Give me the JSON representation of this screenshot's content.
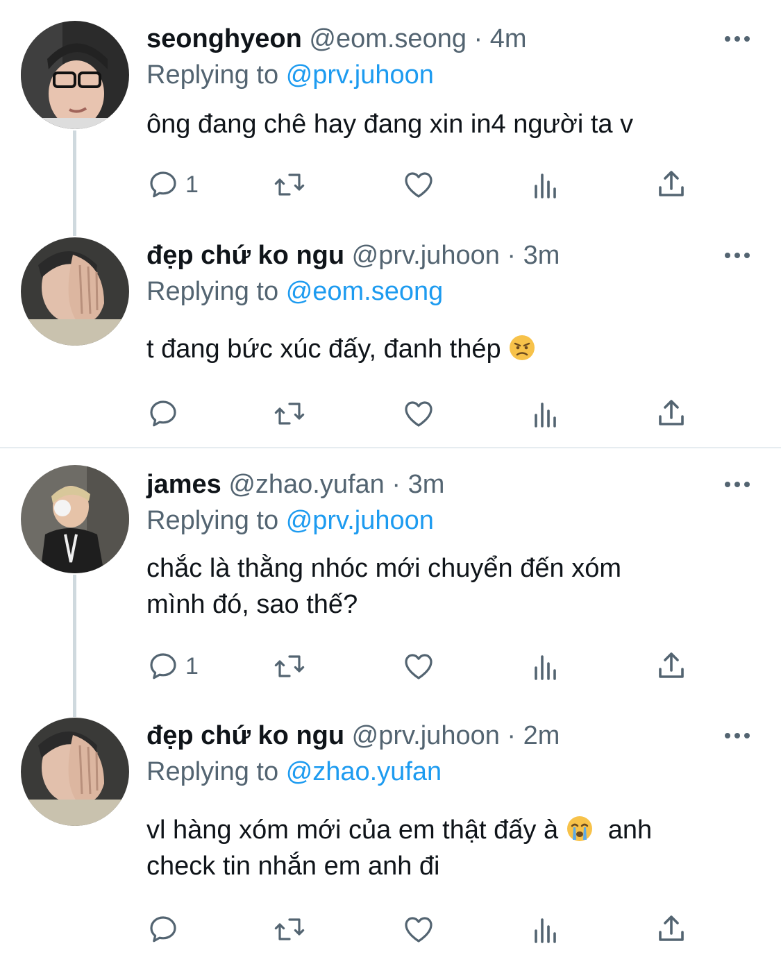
{
  "colors": {
    "text": "#0f1419",
    "secondary": "#536471",
    "link": "#1d9bf0",
    "thread_line": "#cfd9de",
    "divider": "#e6ecf0"
  },
  "tweets": [
    {
      "name": "seonghyeon",
      "handle": "@eom.seong",
      "dot": "·",
      "time": "4m",
      "replying_prefix": "Replying to",
      "replying_to": "@prv.juhoon",
      "text_lines": [
        "ông đang chê hay đang xin in4 người ta v"
      ],
      "reply_count": "1",
      "avatar_icon": "avatar-photo"
    },
    {
      "name": "đẹp chứ ko ngu",
      "handle": "@prv.juhoon",
      "dot": "·",
      "time": "3m",
      "replying_prefix": "Replying to",
      "replying_to": "@eom.seong",
      "text_lines": [
        "t đang bức xúc đấy, đanh thép"
      ],
      "emoji": "angry-face-emoji",
      "reply_count": "",
      "avatar_icon": "avatar-photo"
    },
    {
      "name": "james",
      "handle": "@zhao.yufan",
      "dot": "·",
      "time": "3m",
      "replying_prefix": "Replying to",
      "replying_to": "@prv.juhoon",
      "text_lines": [
        "chắc là thằng nhóc mới chuyển đến xóm",
        "mình đó, sao thế?"
      ],
      "reply_count": "1",
      "avatar_icon": "avatar-photo"
    },
    {
      "name": "đẹp chứ ko ngu",
      "handle": "@prv.juhoon",
      "dot": "·",
      "time": "2m",
      "replying_prefix": "Replying to",
      "replying_to": "@zhao.yufan",
      "text_lines": [
        "vl hàng xóm mới của em thật đấy à",
        " anh",
        "check tin nhắn em anh đi"
      ],
      "emoji": "crying-face-emoji",
      "reply_count": "",
      "avatar_icon": "avatar-photo"
    }
  ],
  "icons": {
    "reply": "reply-icon",
    "retweet": "retweet-icon",
    "like": "heart-icon",
    "views": "views-icon",
    "share": "share-icon",
    "more": "more-icon"
  }
}
